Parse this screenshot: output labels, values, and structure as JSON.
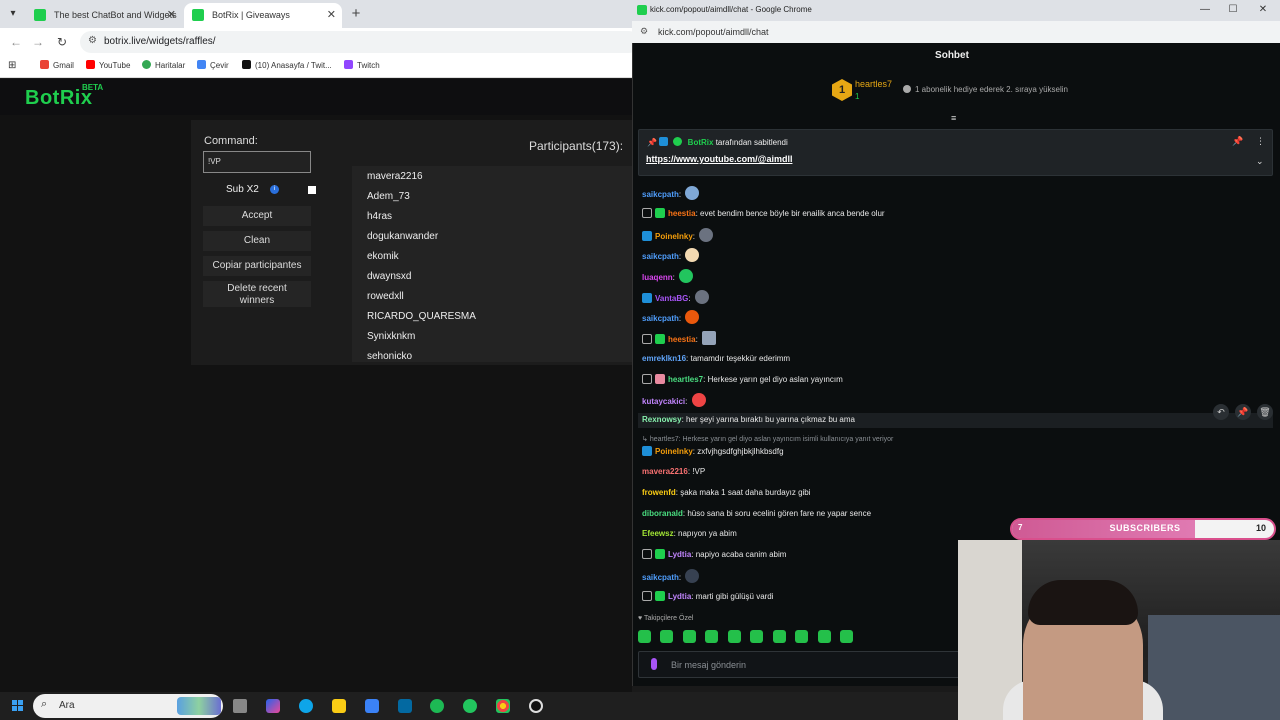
{
  "browser": {
    "tabs": [
      {
        "title": "The best ChatBot and Widgets",
        "active": false
      },
      {
        "title": "BotRix | Giveaways",
        "active": true
      }
    ],
    "url": "botrix.live/widgets/raffles/",
    "bookmarks": [
      "Gmail",
      "YouTube",
      "Haritalar",
      "Çevir",
      "(10) Anasayfa / Twit...",
      "Twitch"
    ]
  },
  "botrix": {
    "logo": "BotRix",
    "logo_badge": "BETA",
    "command_label": "Command:",
    "command_value": "!VP",
    "sub_label": "Sub X2",
    "info_glyph": "i",
    "buttons": {
      "accept": "Accept",
      "clean": "Clean",
      "copy": "Copiar participantes",
      "delete_line1": "Delete recent",
      "delete_line2": "winners"
    },
    "participants_title": "Participants(173):",
    "participants": [
      "mavera2216",
      "Adem_73",
      "h4ras",
      "dogukanwander",
      "ekomik",
      "dwaynsxd",
      "rowedxll",
      "RICARDO_QUARESMA",
      "Synixknkm",
      "sehonicko"
    ]
  },
  "chat_window": {
    "title": "kick.com/popout/aimdll/chat - Google Chrome",
    "url": "kick.com/popout/aimdll/chat",
    "header": "Sohbet",
    "leader": {
      "rank": "1",
      "name": "heartles7",
      "count": "1"
    },
    "gift_hint": "1 abonelik hediye ederek 2. sıraya yükselin",
    "pinned": {
      "by": "BotRix",
      "suffix": "tarafından sabitlendi",
      "link": "https://www.youtube.com/@aimdll"
    },
    "messages": [
      {
        "user": "saikcpath",
        "text": "",
        "color": "#4f9dfb"
      },
      {
        "user": "heestia",
        "text": "evet bendim bence böyle bir enailik anca bende olur",
        "color": "#f97316"
      },
      {
        "user": "PoineInky",
        "text": "",
        "color": "#f59e0b"
      },
      {
        "user": "saikcpath",
        "text": "",
        "color": "#4f9dfb"
      },
      {
        "user": "luaqenn",
        "text": "",
        "color": "#d946ef"
      },
      {
        "user": "VantaBG",
        "text": "",
        "color": "#a855f7"
      },
      {
        "user": "saikcpath",
        "text": "",
        "color": "#4f9dfb"
      },
      {
        "user": "heestia",
        "text": "",
        "color": "#f97316"
      },
      {
        "user": "emreklkn16",
        "text": "tamamdır teşekkür ederimm",
        "color": "#60a5fa"
      },
      {
        "user": "heartles7",
        "text": "Herkese yarın gel diyo aslan yayıncım",
        "color": "#4ade80"
      },
      {
        "user": "kutaycakici",
        "text": "",
        "color": "#c084fc"
      },
      {
        "user": "Rexnowsy",
        "text": "her şeyi yarına bıraktı bu yarına çıkmaz bu ama",
        "color": "#86efac"
      },
      {
        "user": "PoineInky",
        "text": "zxfvjhgsdfghjbkjlhkbsdfg",
        "color": "#f59e0b"
      },
      {
        "user": "mavera2216",
        "text": "!VP",
        "color": "#f87171"
      },
      {
        "user": "frowenfd",
        "text": "şaka maka 1 saat daha burdayız gibi",
        "color": "#facc15"
      },
      {
        "user": "diboranald",
        "text": "hüso sana bi soru ecelini gören fare ne yapar sence",
        "color": "#4ade80"
      },
      {
        "user": "Efeewsz",
        "text": "napıyon ya abim",
        "color": "#a3e635"
      },
      {
        "user": "Lydtia",
        "text": "napiyo acaba canim abim",
        "color": "#c084fc"
      },
      {
        "user": "saikcpath",
        "text": "",
        "color": "#4f9dfb"
      },
      {
        "user": "Lydtia",
        "text": "marti gibi gülüşü vardi",
        "color": "#c084fc"
      }
    ],
    "reply_preview": "heartles7: Herkese yarın gel diyo aslan yayıncım isimli kullanıcıya yanıt veriyor",
    "followers_only": "Takipçilere Özel",
    "input_placeholder": "Bir mesaj gönderin"
  },
  "subscribers_bar": {
    "label": "SUBSCRIBERS",
    "start": "7",
    "end": "10",
    "progress": 0.7
  },
  "taskbar": {
    "search_text": "Ara"
  },
  "colors": {
    "botrix_green": "#1fce4e",
    "kick_green": "#53fc18",
    "gold": "#e6a714",
    "sub_pink": "#d94f8c"
  }
}
